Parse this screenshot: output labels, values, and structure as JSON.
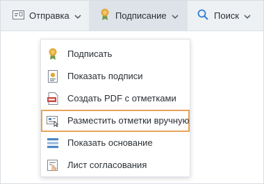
{
  "toolbar": {
    "send_label": "Отправка",
    "sign_label": "Подписание",
    "search_label": "Поиск"
  },
  "menu": {
    "items": [
      {
        "label": "Подписать",
        "icon": "seal-icon"
      },
      {
        "label": "Показать подписи",
        "icon": "certificate-icon"
      },
      {
        "label": "Создать PDF с отметками",
        "icon": "pdf-icon"
      },
      {
        "label": "Разместить отметки вручную",
        "icon": "place-stamps-icon",
        "highlighted": true
      },
      {
        "label": "Показать основание",
        "icon": "list-icon"
      },
      {
        "label": "Лист согласования",
        "icon": "approval-sheet-icon"
      }
    ]
  },
  "colors": {
    "toolbar_bg": "#eef1f4",
    "active_tab_bg": "#dde3e8",
    "highlight_border": "#e8a257",
    "search_icon": "#2f7cd0"
  }
}
